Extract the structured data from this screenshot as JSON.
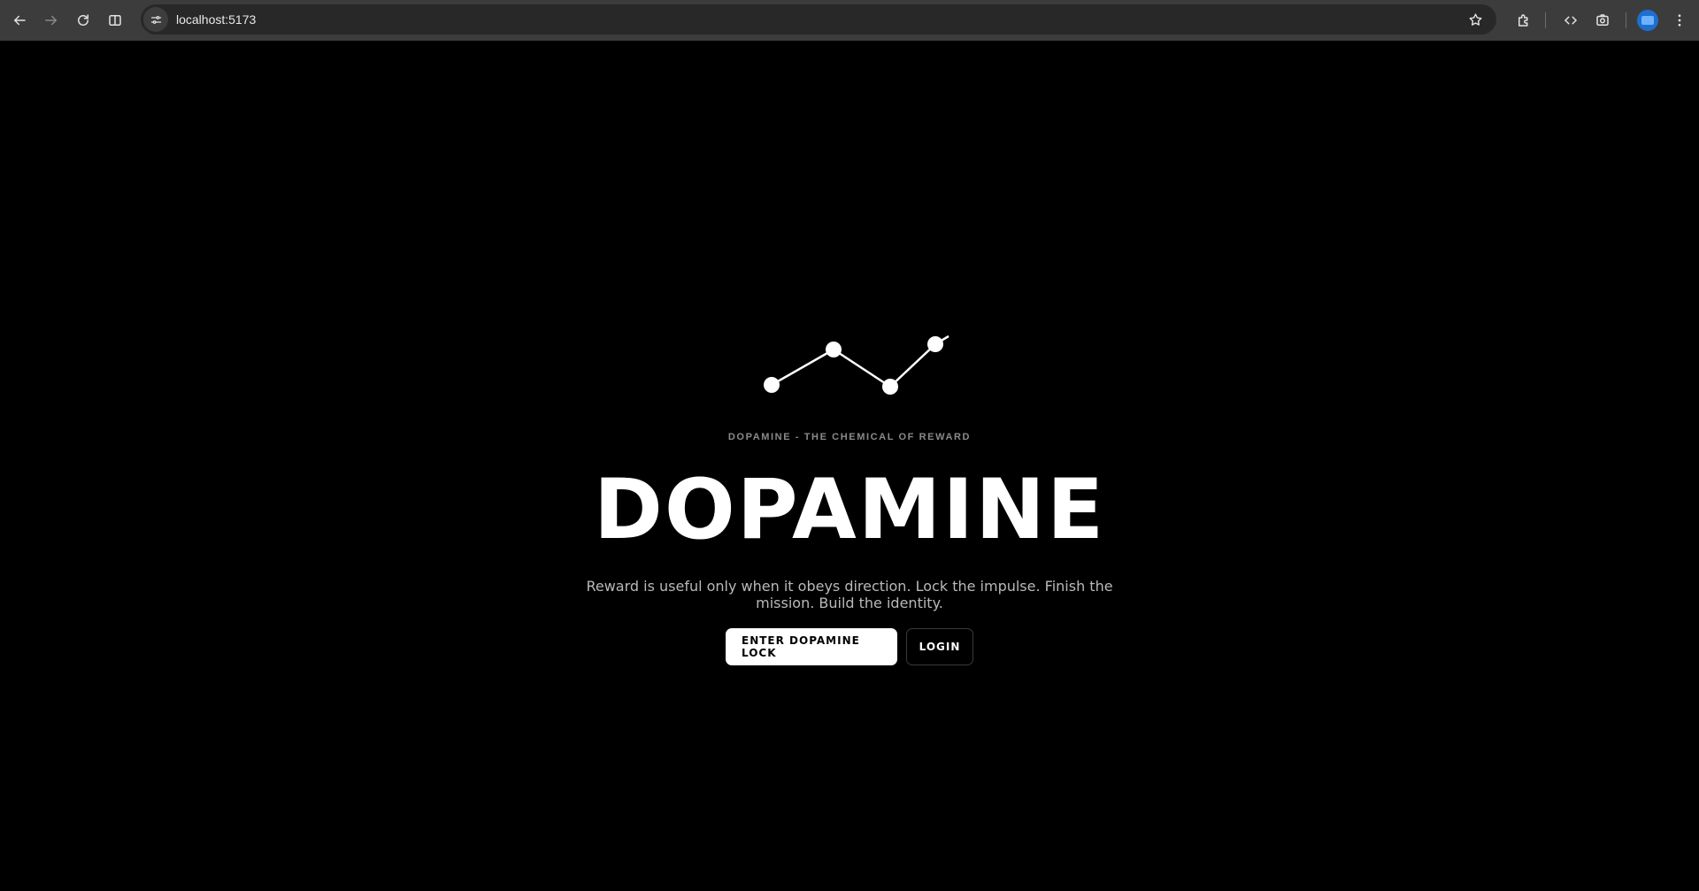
{
  "browser": {
    "url": "localhost:5173",
    "icons": {
      "back": "arrow-left-icon",
      "forward": "arrow-right-icon",
      "reload": "reload-icon",
      "split": "split-view-icon",
      "site_info": "site-settings-icon",
      "bookmark": "star-icon",
      "extensions": "puzzle-icon",
      "devtools": "code-icon",
      "screenshot": "camera-icon",
      "profile": "avatar-icon",
      "menu": "more-vertical-icon"
    }
  },
  "hero": {
    "kicker": "DOPAMINE - THE CHEMICAL OF REWARD",
    "title": "DOPAMINE",
    "tagline": "Reward is useful only when it obeys direction. Lock the impulse. Finish the mission. Build the identity.",
    "primary_cta": "ENTER DOPAMINE LOCK",
    "secondary_cta": "LOGIN"
  },
  "colors": {
    "background": "#000000",
    "text": "#ffffff",
    "muted": "#8a8a8a"
  }
}
